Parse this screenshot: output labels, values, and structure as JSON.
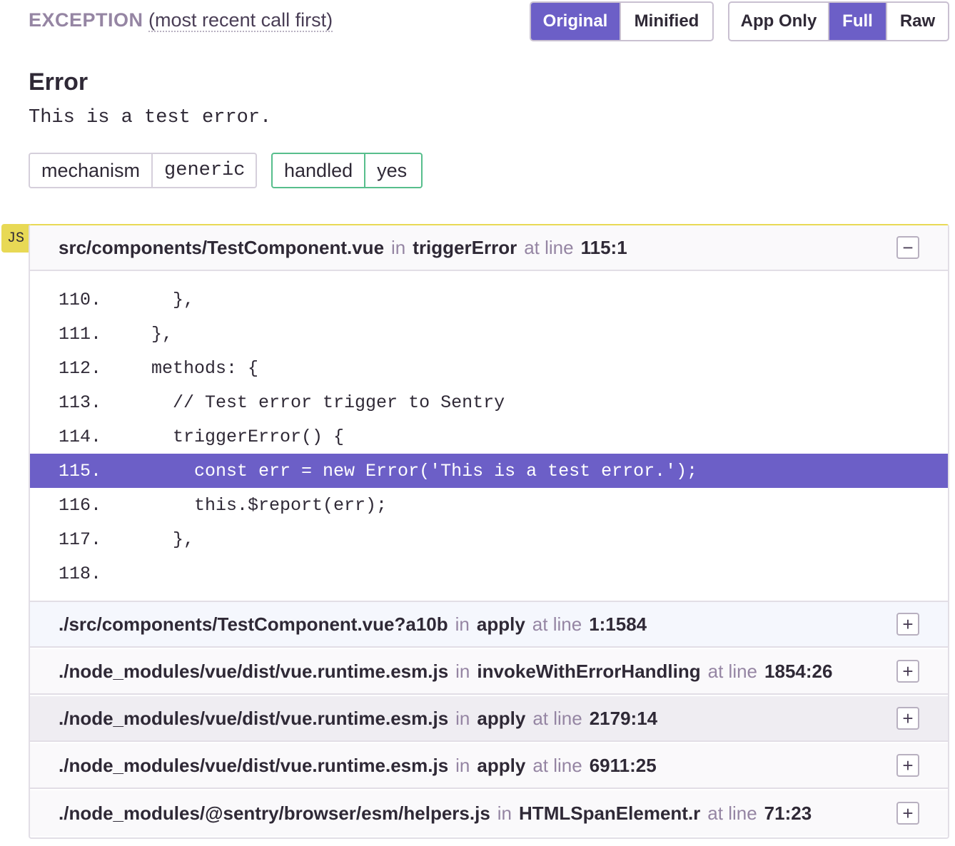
{
  "header": {
    "label": "EXCEPTION",
    "subtitle": "(most recent call first)"
  },
  "toggles": {
    "group_a": [
      "Original",
      "Minified"
    ],
    "group_b": [
      "App Only",
      "Full",
      "Raw"
    ],
    "active": [
      "Original",
      "Full"
    ]
  },
  "error": {
    "type": "Error",
    "value": "This is a test error."
  },
  "tags": {
    "mechanism": {
      "key": "mechanism",
      "value": "generic"
    },
    "handled": {
      "key": "handled",
      "value": "yes"
    }
  },
  "platform_badge": "JS",
  "frames": [
    {
      "file": "src/components/TestComponent.vue",
      "in": "in",
      "function": "triggerError",
      "at": "at line",
      "line": "115:1",
      "toggle": "−"
    },
    {
      "file": "./src/components/TestComponent.vue?a10b",
      "in": "in",
      "function": "apply",
      "at": "at line",
      "line": "1:1584",
      "toggle": "+"
    },
    {
      "file": "./node_modules/vue/dist/vue.runtime.esm.js",
      "in": "in",
      "function": "invokeWithErrorHandling",
      "at": "at line",
      "line": "1854:26",
      "toggle": "+"
    },
    {
      "file": "./node_modules/vue/dist/vue.runtime.esm.js",
      "in": "in",
      "function": "apply",
      "at": "at line",
      "line": "2179:14",
      "toggle": "+"
    },
    {
      "file": "./node_modules/vue/dist/vue.runtime.esm.js",
      "in": "in",
      "function": "apply",
      "at": "at line",
      "line": "6911:25",
      "toggle": "+"
    },
    {
      "file": "./node_modules/@sentry/browser/esm/helpers.js",
      "in": "in",
      "function": "HTMLSpanElement.r",
      "at": "at line",
      "line": "71:23",
      "toggle": "+"
    }
  ],
  "code": [
    {
      "num": "110.",
      "text": "    },"
    },
    {
      "num": "111.",
      "text": "  },"
    },
    {
      "num": "112.",
      "text": "  methods: {"
    },
    {
      "num": "113.",
      "text": "    // Test error trigger to Sentry"
    },
    {
      "num": "114.",
      "text": "    triggerError() {"
    },
    {
      "num": "115.",
      "text": "      const err = new Error('This is a test error.');"
    },
    {
      "num": "116.",
      "text": "      this.$report(err);"
    },
    {
      "num": "117.",
      "text": "    },"
    },
    {
      "num": "118.",
      "text": ""
    }
  ],
  "colors": {
    "accent": "#6c5fc7",
    "badge": "#e8d955",
    "handled_border": "#57be8c"
  }
}
